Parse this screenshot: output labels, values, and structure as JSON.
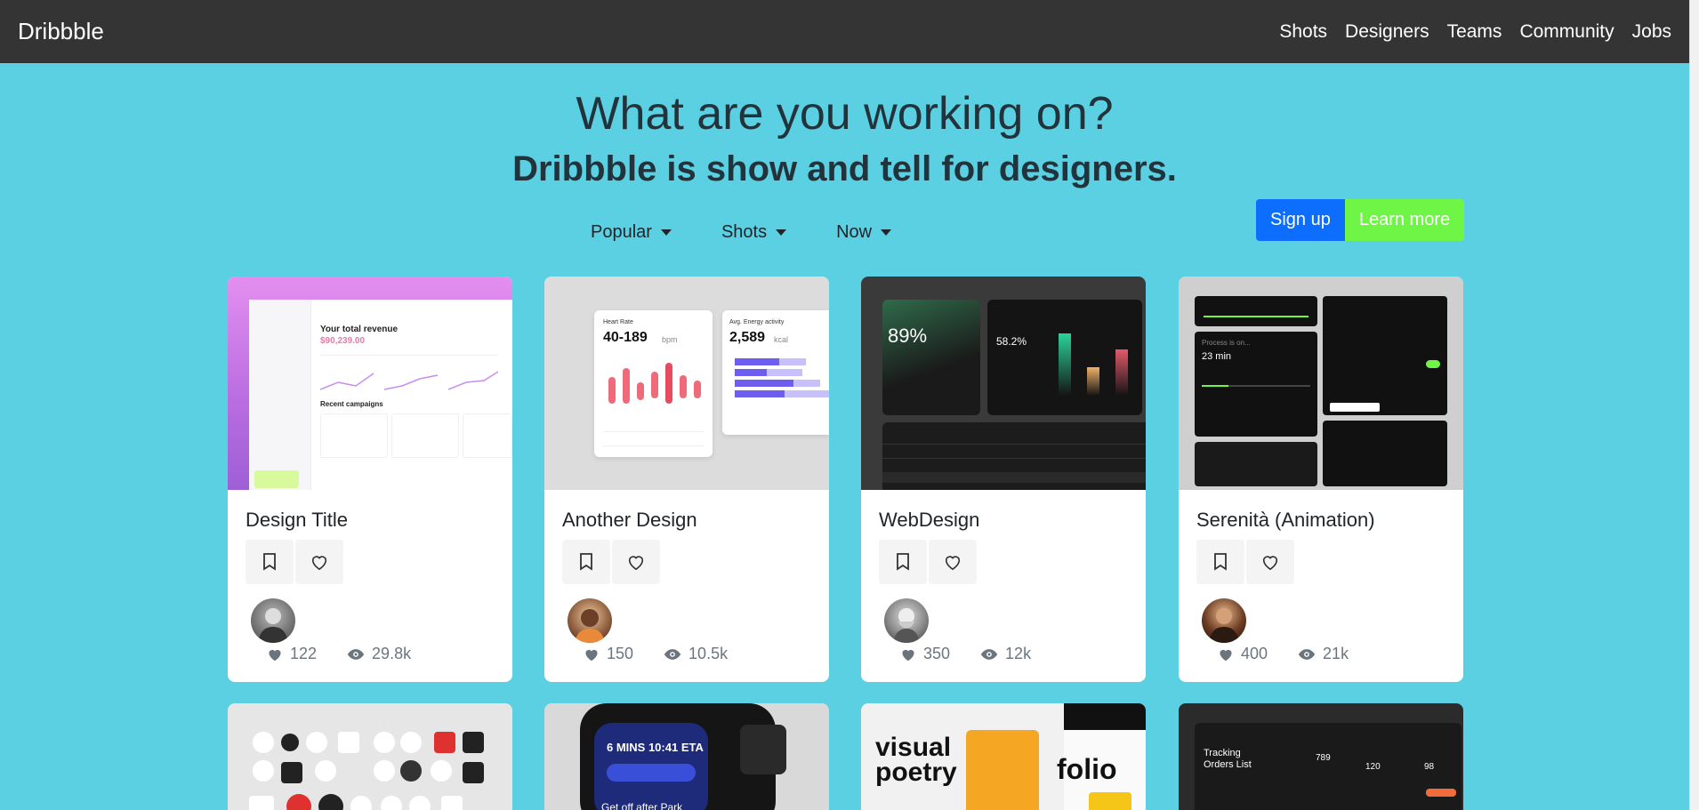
{
  "nav": {
    "brand": "Dribbble",
    "links": [
      "Shots",
      "Designers",
      "Teams",
      "Community",
      "Jobs"
    ]
  },
  "hero": {
    "title": "What are you working on?",
    "subtitle": "Dribbble is show and tell for designers."
  },
  "filters": [
    "Popular",
    "Shots",
    "Now"
  ],
  "cta": {
    "signup": "Sign up",
    "learn_more": "Learn more"
  },
  "cards": [
    {
      "title": "Design Title",
      "likes": "122",
      "views": "29.8k"
    },
    {
      "title": "Another Design",
      "likes": "150",
      "views": "10.5k"
    },
    {
      "title": "WebDesign",
      "likes": "350",
      "views": "12k"
    },
    {
      "title": "Serenità (Animation)",
      "likes": "400",
      "views": "21k"
    }
  ],
  "thumb_text": {
    "c1_revenue_label": "Your total revenue",
    "c1_revenue_value": "$90,239.00",
    "c1_campaigns": "Recent campaigns",
    "c2_heart_label": "Heart Rate",
    "c2_heart_value": "40-189",
    "c2_heart_unit": "bpm",
    "c2_energy_label": "Avg. Energy activity",
    "c2_energy_value": "2,589",
    "c2_energy_unit": "kcal",
    "c3_percent": "89%",
    "c3_percent2": "58.2%",
    "c4_process": "Process is on...",
    "c4_time": "23 min",
    "r2_watch_top": "6 MINS 10:41 ETA",
    "r2_watch_bottom": "Get off after Park Lane",
    "r2_poster_line1": "visual",
    "r2_poster_line2": "poetry",
    "r2_poster_folio": "folio",
    "r2_tracking": "Tracking Orders List",
    "r2_stat1": "789",
    "r2_stat2": "120",
    "r2_stat3": "98"
  },
  "colors": {
    "navbar": "#343434",
    "background": "#5bd0e3",
    "signup": "#0d6efd",
    "learn_more": "#6ff546"
  }
}
